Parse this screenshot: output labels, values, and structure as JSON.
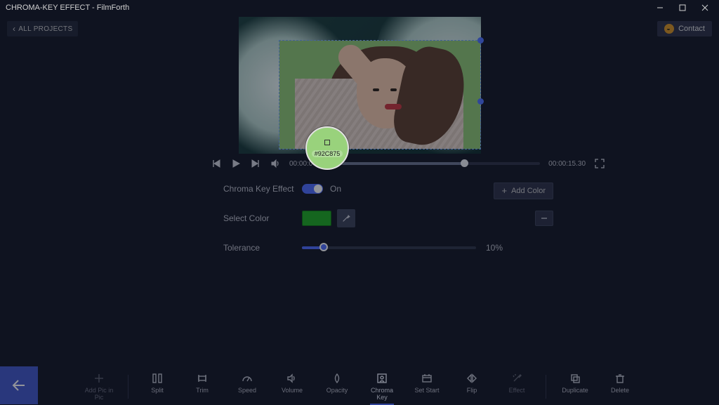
{
  "titlebar": {
    "title": "CHROMA-KEY EFFECT - FilmForth"
  },
  "toprow": {
    "all_projects": "ALL PROJECTS",
    "contact": "Contact"
  },
  "sampler": {
    "hex": "#92C875"
  },
  "player": {
    "current_time": "00:00:09",
    "total_time": "00:00:15.30",
    "progress_pct": 64
  },
  "panel": {
    "effect_label": "Chroma Key Effect",
    "toggle_label": "On",
    "add_color": "Add Color",
    "select_color_label": "Select Color",
    "swatch_hex": "#1cab1f",
    "tolerance_label": "Tolerance",
    "tolerance_value": "10%"
  },
  "toolbar": {
    "items": [
      {
        "label": "Add Pic in Pic"
      },
      {
        "label": "Split"
      },
      {
        "label": "Trim"
      },
      {
        "label": "Speed"
      },
      {
        "label": "Volume"
      },
      {
        "label": "Opacity"
      },
      {
        "label": "Chroma Key",
        "selected": true
      },
      {
        "label": "Set Start"
      },
      {
        "label": "Flip"
      },
      {
        "label": "Effect"
      },
      {
        "label": "Duplicate"
      },
      {
        "label": "Delete"
      }
    ]
  }
}
